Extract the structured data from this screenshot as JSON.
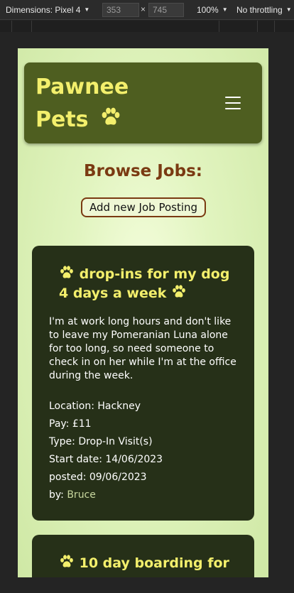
{
  "devtools": {
    "device": "Dimensions: Pixel 4",
    "width": "353",
    "times": "×",
    "height": "745",
    "zoom": "100%",
    "throttling": "No throttling"
  },
  "header": {
    "brand_line1": "Pawnee",
    "brand_line2": "Pets"
  },
  "page": {
    "title": "Browse Jobs:",
    "add_button": "Add new Job Posting"
  },
  "jobs": [
    {
      "title": "drop-ins for my dog 4 days a week",
      "description": "I'm at work long hours and don't like to leave my Pomeranian Luna alone for too long, so need someone to check in on her while I'm at the office during the week.",
      "location": "Location: Hackney",
      "pay": "Pay: £11",
      "type": "Type: Drop-In Visit(s)",
      "start": "Start date: 14/06/2023",
      "posted": "posted: 09/06/2023",
      "by_label": "by:",
      "author": "Bruce"
    },
    {
      "title": "10 day boarding for"
    }
  ],
  "colors": {
    "header_bg": "#4e5e20",
    "brand": "#f3ef6c",
    "card_bg": "#263018",
    "title_brown": "#7a3a12"
  },
  "icons": [
    "paw-icon",
    "hamburger-menu-icon",
    "caret-down-icon"
  ]
}
